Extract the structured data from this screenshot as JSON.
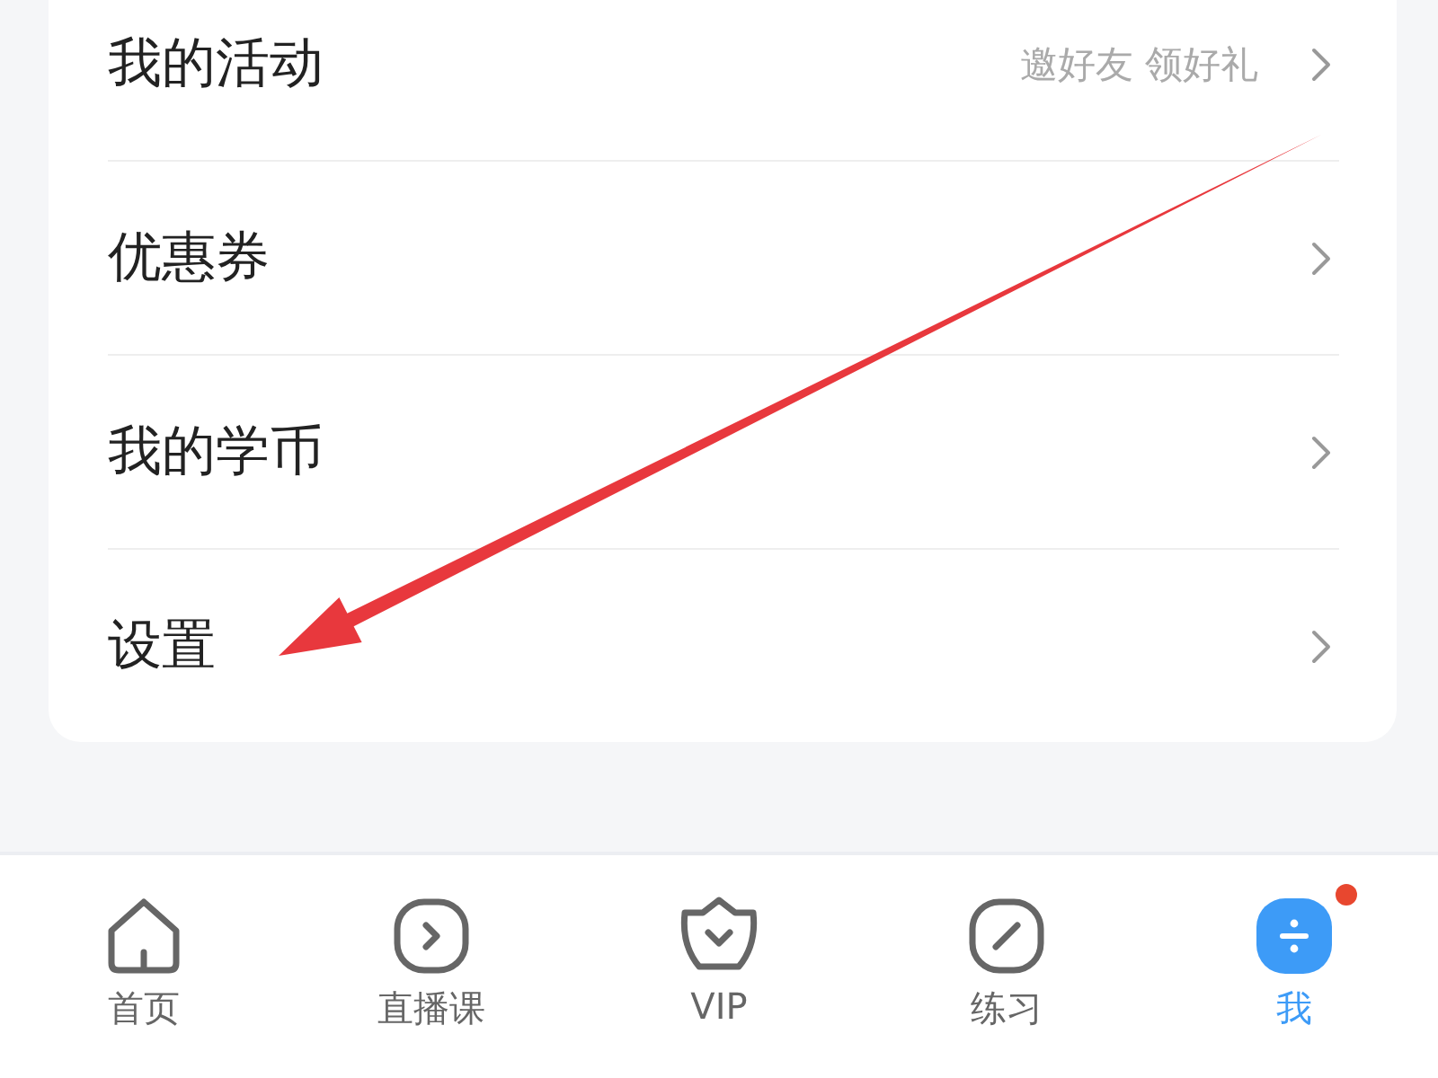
{
  "menu": [
    {
      "label": "我的活动",
      "hint": "邀好友 领好礼"
    },
    {
      "label": "优惠券"
    },
    {
      "label": "我的学币"
    },
    {
      "label": "设置"
    }
  ],
  "tabs": [
    {
      "label": "首页",
      "kind": "home",
      "selected": false,
      "dot": false
    },
    {
      "label": "直播课",
      "kind": "live",
      "selected": false,
      "dot": false
    },
    {
      "label": "VIP",
      "kind": "vip",
      "selected": false,
      "dot": false
    },
    {
      "label": "练习",
      "kind": "practice",
      "selected": false,
      "dot": false
    },
    {
      "label": "我",
      "kind": "me",
      "selected": true,
      "dot": true
    }
  ]
}
